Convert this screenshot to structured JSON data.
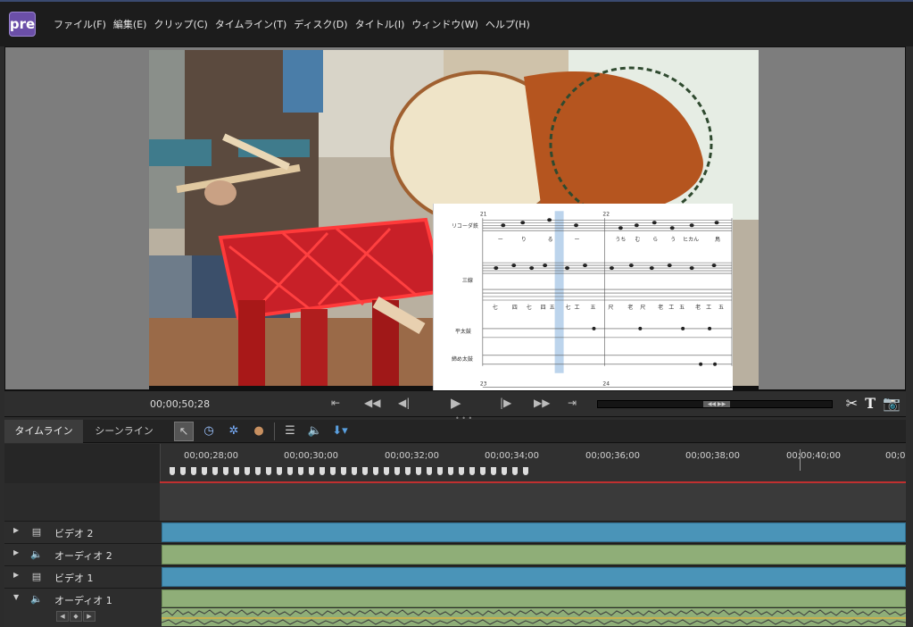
{
  "app": {
    "logo": "pre"
  },
  "menu": [
    "ファイル(F)",
    "編集(E)",
    "クリップ(C)",
    "タイムライン(T)",
    "ディスク(D)",
    "タイトル(I)",
    "ウィンドウ(W)",
    "ヘルプ(H)"
  ],
  "monitor": {
    "timecode": "00;00;50;28",
    "score": {
      "part_labels": [
        "リコーダ鉄",
        "三線",
        "平太鼓",
        "締め太鼓"
      ],
      "measure_numbers": [
        "21",
        "22",
        "23",
        "24"
      ],
      "lyrics": [
        "ー",
        "り",
        "る",
        "ー",
        "うち",
        "む",
        "ら",
        "う",
        "ヒカん",
        "鳥"
      ],
      "tab_chars": [
        "七",
        "四",
        "七",
        "四",
        "五",
        "七",
        "工",
        "五",
        "尺",
        "老",
        "尺",
        "老",
        "工",
        "五",
        "老",
        "工",
        "五"
      ]
    }
  },
  "transport": {
    "buttons": [
      "trim-in",
      "rewind",
      "step-back",
      "play",
      "step-forward",
      "fast-forward",
      "trim-out"
    ],
    "tools": [
      "scissors-icon",
      "text-icon",
      "camera-icon"
    ]
  },
  "tabs": {
    "timeline": "タイムライン",
    "sceneline": "シーンライン"
  },
  "ruler": {
    "labels": [
      "00;00;28;00",
      "00;00;30;00",
      "00;00;32;00",
      "00;00;34;00",
      "00;00;36;00",
      "00;00;38;00",
      "00;00;40;00",
      "00;0"
    ]
  },
  "tracks": [
    {
      "name": "ビデオ 2",
      "type": "video",
      "expanded": false
    },
    {
      "name": "オーディオ 2",
      "type": "audio",
      "expanded": false
    },
    {
      "name": "ビデオ 1",
      "type": "video",
      "expanded": false
    },
    {
      "name": "オーディオ 1",
      "type": "audio",
      "expanded": true
    }
  ],
  "colors": {
    "video_clip": "#4a94b8",
    "audio_clip": "#8fae78",
    "playhead": "#c03030",
    "logo_bg": "#6b4fa8"
  }
}
